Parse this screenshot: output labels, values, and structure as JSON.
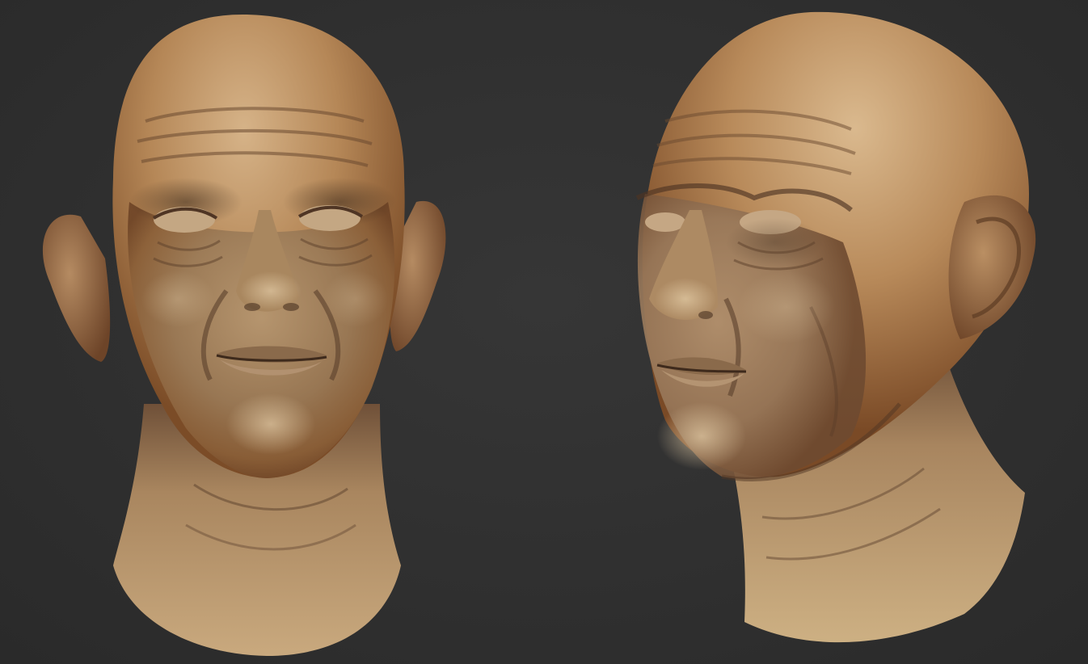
{
  "scene": {
    "background_color": "#2f2f2f",
    "clay_colors": {
      "highlight": "#d9b98e",
      "mid": "#a8855e",
      "shadow": "#5e4330",
      "rim": "#c2783e"
    },
    "views": [
      {
        "name": "front-view",
        "icon": "sculpted-head-front"
      },
      {
        "name": "three-quarter-view",
        "icon": "sculpted-head-three-quarter"
      }
    ]
  }
}
